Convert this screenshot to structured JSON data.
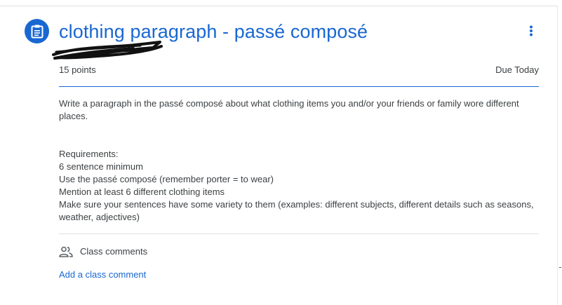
{
  "assignment": {
    "icon": "assignment-icon",
    "title": "clothing paragraph - passé composé",
    "points": "15 points",
    "due": "Due Today",
    "more_icon": "more-vert-icon",
    "description": "Write a paragraph in the passé composé about what clothing items you and/or your friends or family wore different places.",
    "requirements": [
      "Requirements:",
      "6 sentence minimum",
      "Use the passé composé (remember porter = to wear)",
      "Mention at least 6 different clothing items",
      "Make sure your sentences have some variety to them (examples: different subjects, different details such as seasons, weather, adjectives)"
    ]
  },
  "comments": {
    "icon": "people-icon",
    "label": "Class comments",
    "add_link": "Add a class comment"
  },
  "colors": {
    "accent": "#1967d2",
    "text": "#3c4043",
    "divider": "#e0e0e0"
  }
}
